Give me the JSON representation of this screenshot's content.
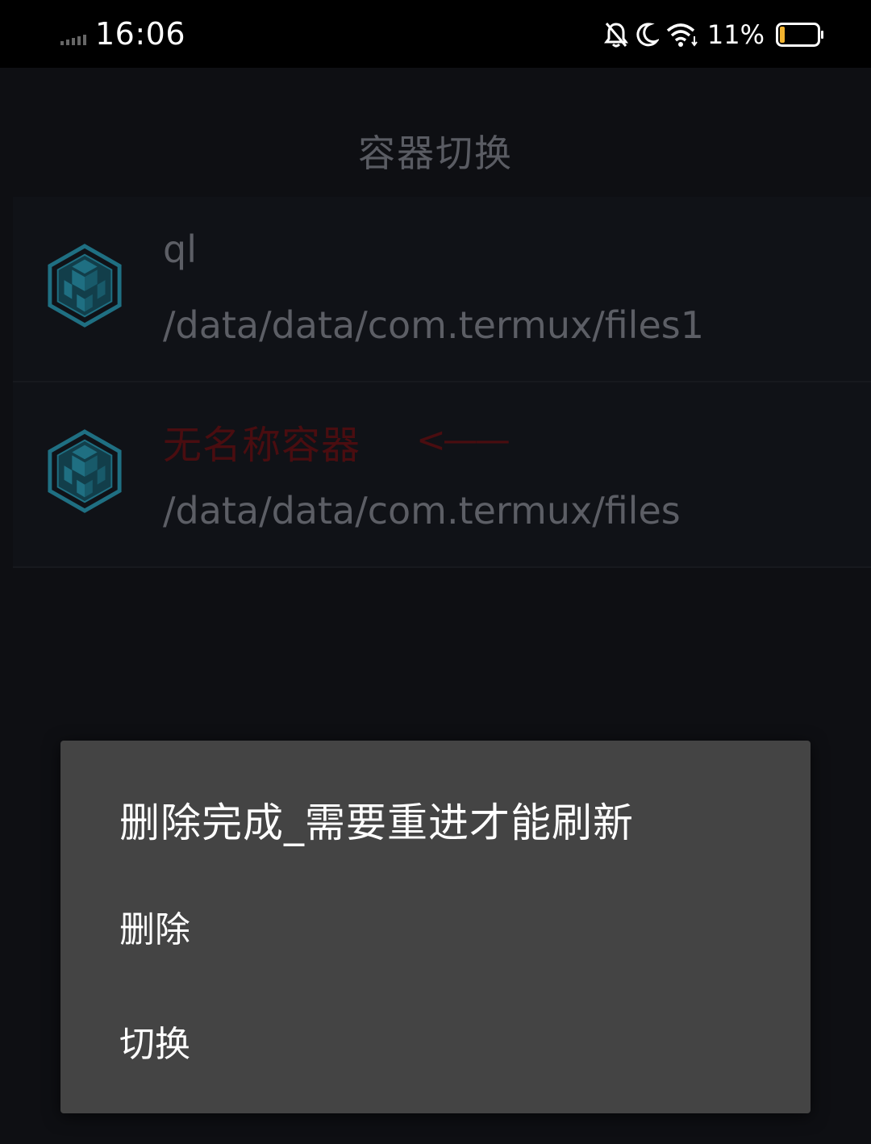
{
  "status_bar": {
    "time": "16:06",
    "battery_percent": "11%",
    "battery_level": 0.11,
    "icons": [
      "signal-icon",
      "bell-off-icon",
      "moon-icon",
      "wifi-icon",
      "battery-icon"
    ]
  },
  "page": {
    "title": "容器切换"
  },
  "containers": [
    {
      "name": "ql",
      "path": "/data/data/com.termux/files1",
      "icon": "cube-icon"
    },
    {
      "name": "无名称容器",
      "path": "/data/data/com.termux/files",
      "annotation": "<——",
      "name_color": "#4a0d10",
      "icon": "cube-icon"
    }
  ],
  "dialog": {
    "title": "删除完成_需要重进才能刷新",
    "items": [
      {
        "label": "删除"
      },
      {
        "label": "切换"
      }
    ]
  },
  "colors": {
    "status_bar_bg": "#000000",
    "app_bg": "#0e0f13",
    "dialog_bg": "#444444",
    "icon_teal": "#1f6f82"
  }
}
